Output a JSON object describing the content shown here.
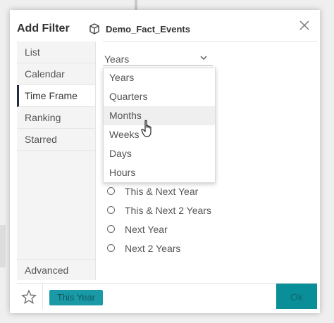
{
  "dialog": {
    "title": "Add Filter",
    "source_icon": "cube-icon",
    "source_name": "Demo_Fact_Events",
    "close_icon": "close-icon"
  },
  "sidebar": {
    "items": [
      {
        "label": "List"
      },
      {
        "label": "Calendar"
      },
      {
        "label": "Time Frame",
        "active": true
      },
      {
        "label": "Ranking"
      },
      {
        "label": "Starred"
      }
    ],
    "advanced_label": "Advanced"
  },
  "period_select": {
    "value": "Years",
    "options": [
      "Years",
      "Quarters",
      "Months",
      "Weeks",
      "Days",
      "Hours"
    ],
    "hovered": "Months"
  },
  "timeframe_options": [
    "This & Next Year",
    "This & Next 2 Years",
    "Next Year",
    "Next 2 Years"
  ],
  "footer": {
    "star_icon": "star-icon",
    "chip_label": "This Year",
    "ok_label": "Ok"
  },
  "colors": {
    "accent": "#0a8f99",
    "chip": "#1a9aa6",
    "active_border": "#1f2d3d"
  }
}
